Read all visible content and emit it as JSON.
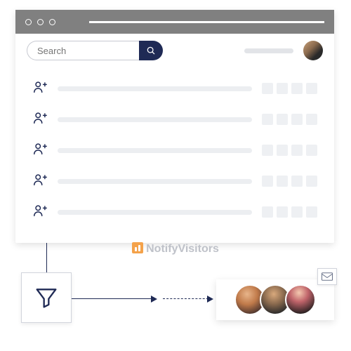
{
  "colors": {
    "accent": "#1f2a55",
    "titlebar": "#808080"
  },
  "search": {
    "placeholder": "Search"
  },
  "watermark": {
    "text": "NotifyVisitors"
  }
}
